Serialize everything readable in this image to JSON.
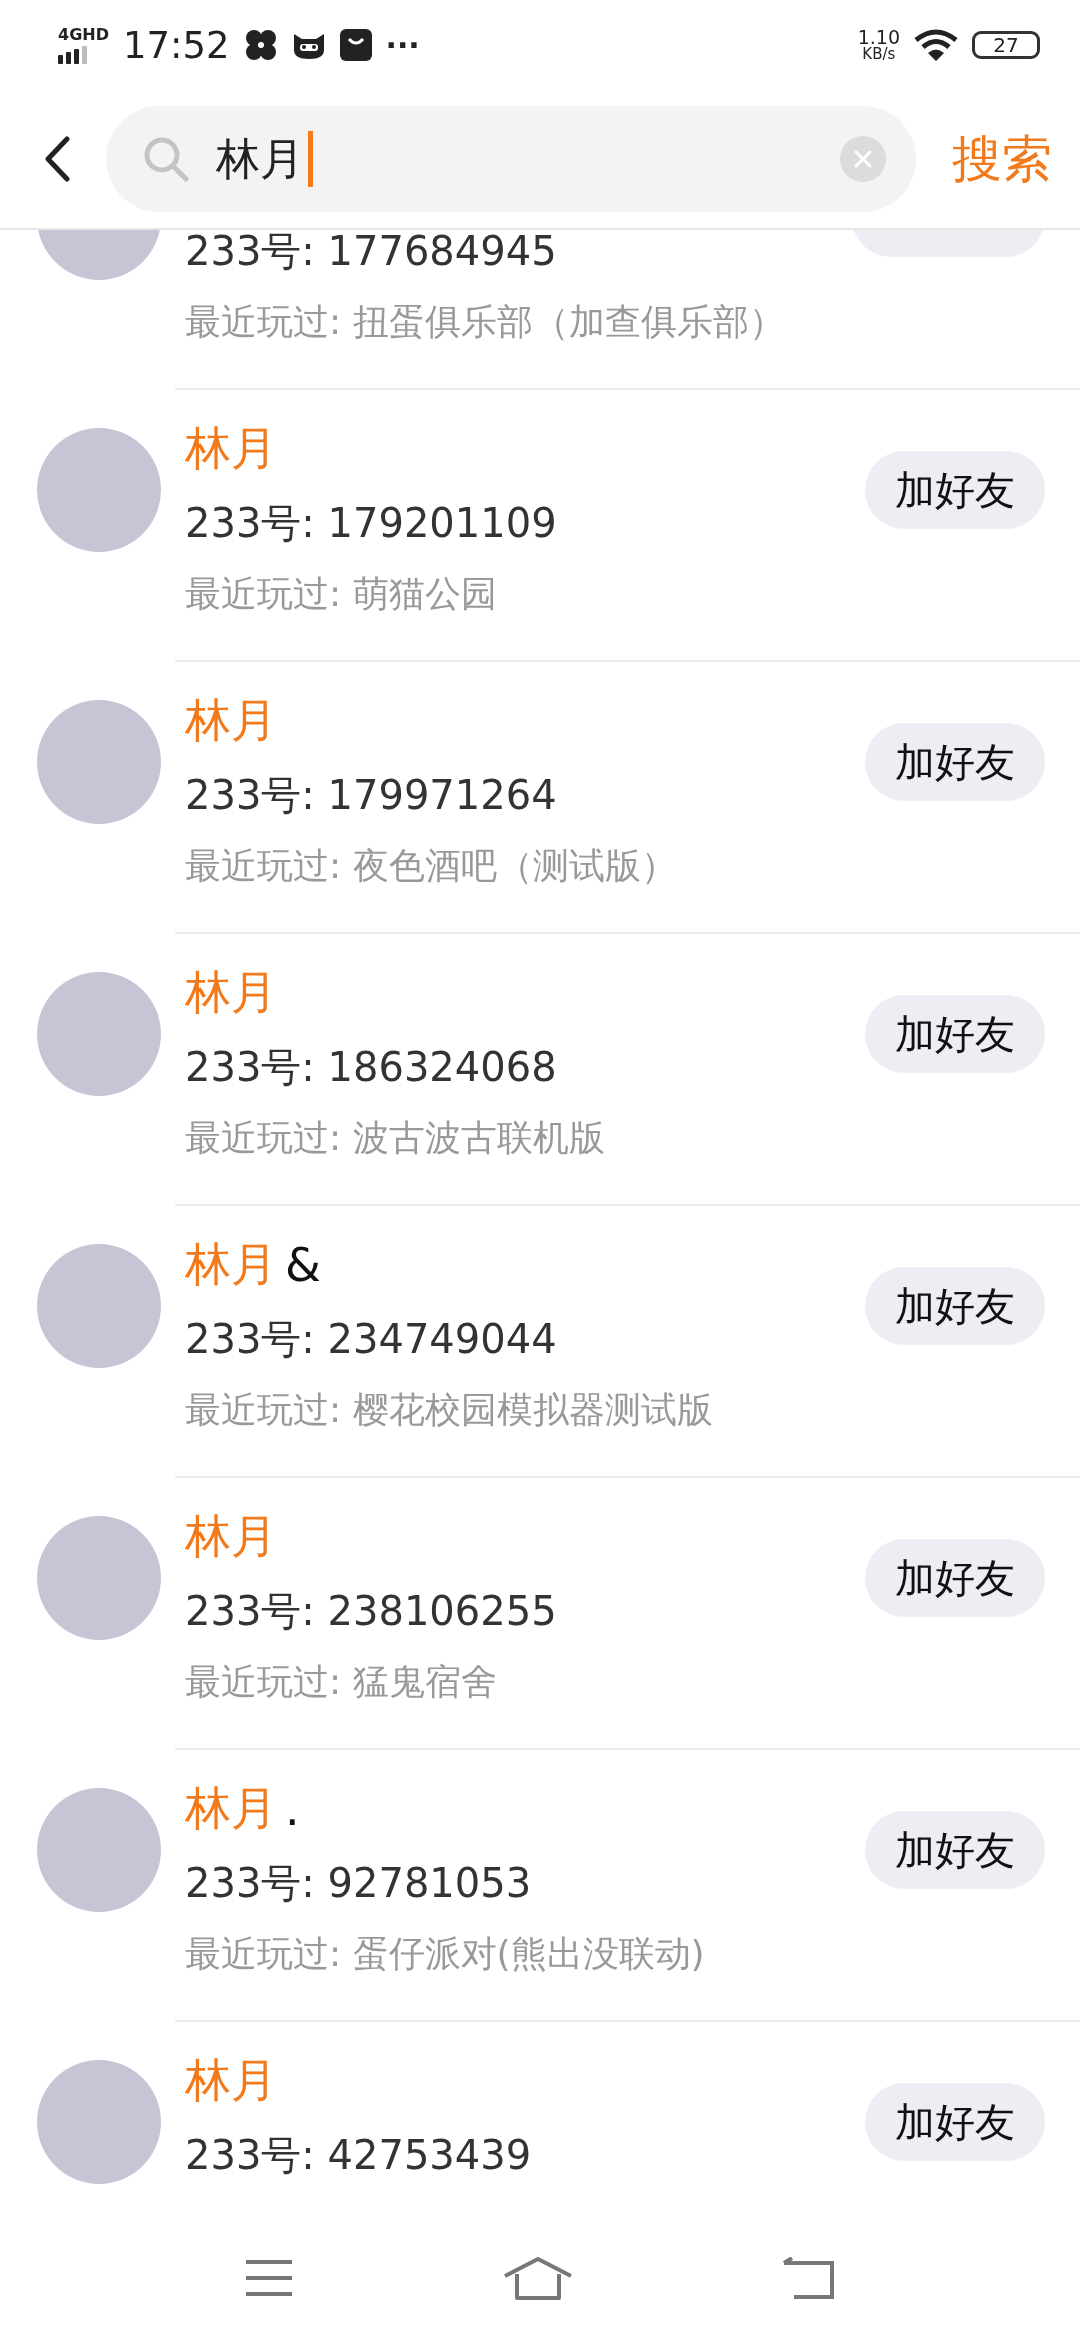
{
  "status_bar": {
    "network": "4GHD",
    "time": "17:52",
    "more": "···",
    "speed_value": "1.10",
    "speed_unit": "KB/s",
    "battery": "27"
  },
  "search": {
    "value": "林月",
    "button": "搜索"
  },
  "results": [
    {
      "kind": "partial",
      "id": "233号: 177684945",
      "recent": "最近玩过: 扭蛋俱乐部（加查俱乐部）"
    },
    {
      "kind": "full",
      "name": "林月",
      "id": "233号: 179201109",
      "recent": "最近玩过: 萌猫公园",
      "button": "加好友"
    },
    {
      "kind": "full",
      "name": "林月",
      "id": "233号: 179971264",
      "recent": "最近玩过: 夜色酒吧（测试版）",
      "button": "加好友"
    },
    {
      "kind": "full",
      "name": "林月",
      "id": "233号: 186324068",
      "recent": "最近玩过: 波古波古联机版",
      "button": "加好友"
    },
    {
      "kind": "full",
      "name": "林月",
      "name_suffix": "&",
      "id": "233号: 234749044",
      "recent": "最近玩过: 樱花校园模拟器测试版",
      "button": "加好友"
    },
    {
      "kind": "full",
      "name": "林月",
      "id": "233号: 238106255",
      "recent": "最近玩过: 猛鬼宿舍",
      "button": "加好友"
    },
    {
      "kind": "full",
      "name": "林月",
      "name_suffix": ".",
      "id": "233号: 92781053",
      "recent": "最近玩过: 蛋仔派对(熊出没联动)",
      "button": "加好友"
    },
    {
      "kind": "full",
      "name": "林月",
      "id": "233号: 42753439",
      "button": "加好友"
    }
  ]
}
